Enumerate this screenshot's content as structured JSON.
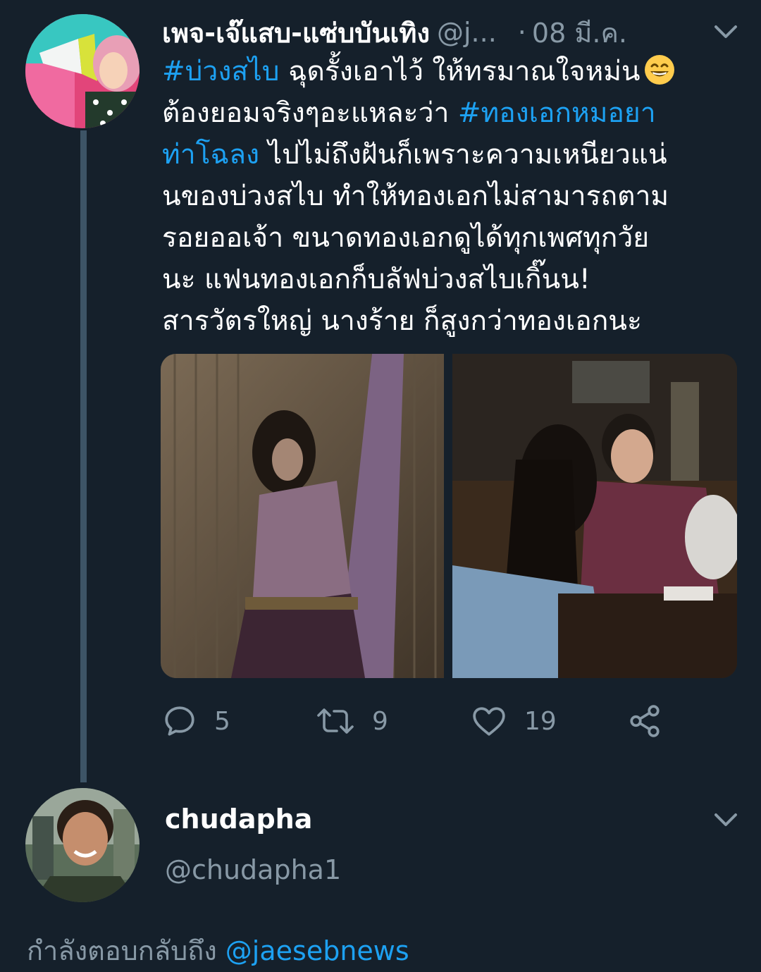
{
  "tweet": {
    "display_name": "เพจ-เจ๊แสบ-แซ่บบันเทิง",
    "handle": "@j...",
    "separator": "·",
    "date": "08 มี.ค.",
    "lines": [
      [
        {
          "t": "#บ่วงสไบ",
          "h": true
        },
        {
          "t": " ฉุดรั้งเอาไว้ ให้ทรมาณใจหม่น",
          "h": false
        }
      ],
      [
        {
          "t": "ต้องยอมจริงๆอะแหละว่า ",
          "h": false
        },
        {
          "t": "#ทองเอกหมอยา",
          "h": true
        }
      ],
      [
        {
          "t": "ท่าโฉลง",
          "h": true
        },
        {
          "t": " ไปไม่ถึงฝันก็เพราะความเหนียวแน่",
          "h": false
        }
      ],
      [
        {
          "t": "นของบ่วงสไบ ทำให้ทองเอกไม่สามารถตาม",
          "h": false
        }
      ],
      [
        {
          "t": "รอยออเจ้า ขนาดทองเอกดูได้ทุกเพศทุกวัย",
          "h": false
        }
      ],
      [
        {
          "t": "นะ แฟนทองเอกก็บลัฟบ่วงสไบเกิ๊นน!",
          "h": false
        }
      ],
      [
        {
          "t": "สารวัตรใหญ่ นางร้าย ก็สูงกว่าทองเอกนะ",
          "h": false
        }
      ]
    ],
    "emoji_icon": "grinning-smiling-eyes-emoji",
    "actions": {
      "reply_count": "5",
      "retweet_count": "9",
      "like_count": "19"
    }
  },
  "reply_composer": {
    "display_name": "chudapha",
    "handle": "@chudapha1",
    "replying_to_label": "กำลังตอบกลับถึง",
    "replying_to_handle": "@jaesebnews"
  },
  "colors": {
    "background": "#15202b",
    "text_primary": "#ffffff",
    "text_secondary": "#8899a6",
    "link": "#1da1f2",
    "thread_line": "#3d5466"
  },
  "icons": [
    "reply-icon",
    "retweet-icon",
    "like-icon",
    "share-icon",
    "chevron-down-icon"
  ]
}
